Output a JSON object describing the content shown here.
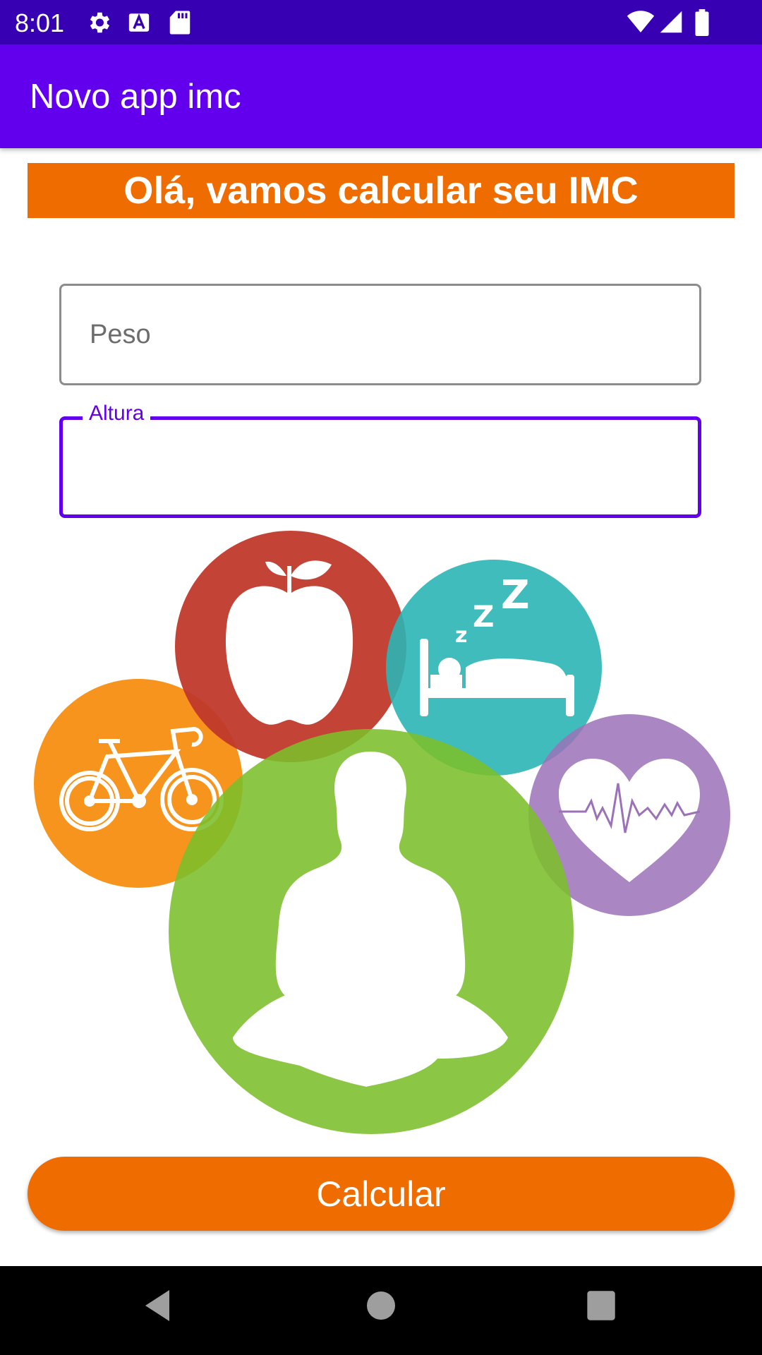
{
  "status_bar": {
    "time": "8:01",
    "left_icons": [
      "gear-icon",
      "font-a-icon",
      "sd-card-icon"
    ],
    "right_icons": [
      "wifi-icon",
      "cellular-signal-icon",
      "battery-icon"
    ]
  },
  "app_bar": {
    "title": "Novo app imc"
  },
  "banner": {
    "text": "Olá, vamos calcular seu IMC"
  },
  "form": {
    "weight": {
      "placeholder": "Peso",
      "value": ""
    },
    "height": {
      "label": "Altura",
      "value": ""
    }
  },
  "illustration": {
    "icons": [
      "bicycle-icon",
      "apple-icon",
      "sleeping-bed-icon",
      "heart-rate-icon",
      "meditation-person-icon"
    ]
  },
  "button": {
    "label": "Calcular"
  },
  "nav_bar": {
    "buttons": [
      "back-icon",
      "home-icon",
      "recents-icon"
    ]
  },
  "colors": {
    "status_bar": "#3700b3",
    "app_bar": "#6200ee",
    "accent": "#ef6c00",
    "apple": "#c0392b",
    "sleep": "#3bbdbd",
    "heart": "#a07ebc",
    "bike": "#f7941d",
    "meditation": "#8dc63f"
  }
}
